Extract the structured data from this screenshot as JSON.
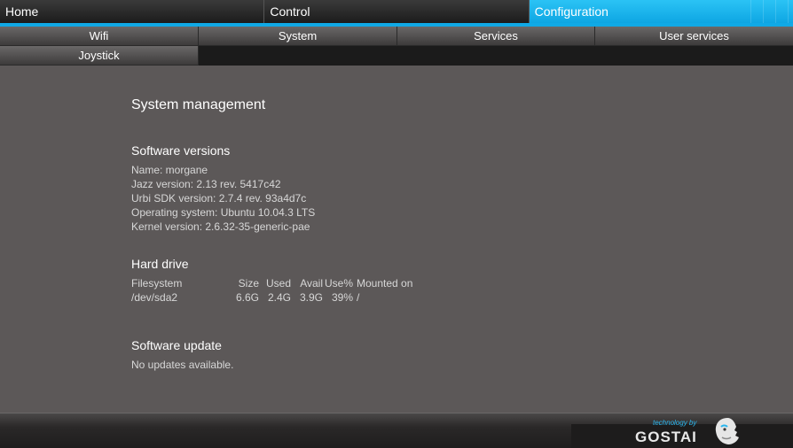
{
  "top_tabs": [
    {
      "label": "Home",
      "active": false
    },
    {
      "label": "Control",
      "active": false
    },
    {
      "label": "Configuration",
      "active": true
    }
  ],
  "sub_tabs": [
    {
      "label": "Wifi"
    },
    {
      "label": "System"
    },
    {
      "label": "Services"
    },
    {
      "label": "User services"
    },
    {
      "label": "Joystick"
    }
  ],
  "page_title": "System management",
  "software_versions": {
    "title": "Software versions",
    "lines": [
      "Name: morgane",
      "Jazz version: 2.13 rev. 5417c42",
      "Urbi SDK version: 2.7.4 rev. 93a4d7c",
      "Operating system: Ubuntu 10.04.3 LTS",
      "Kernel version: 2.6.32-35-generic-pae"
    ]
  },
  "hard_drive": {
    "title": "Hard drive",
    "headers": [
      "Filesystem",
      "Size",
      "Used",
      "Avail",
      "Use%",
      "Mounted on"
    ],
    "rows": [
      [
        "/dev/sda2",
        "6.6G",
        "2.4G",
        "3.9G",
        "39%",
        "/"
      ]
    ]
  },
  "software_update": {
    "title": "Software update",
    "status": "No updates available."
  },
  "branding": {
    "tagline": "technology by",
    "name": "GOSTAI",
    "logo_icon": "gostai-face-icon",
    "accent_color": "#10a9e6"
  }
}
